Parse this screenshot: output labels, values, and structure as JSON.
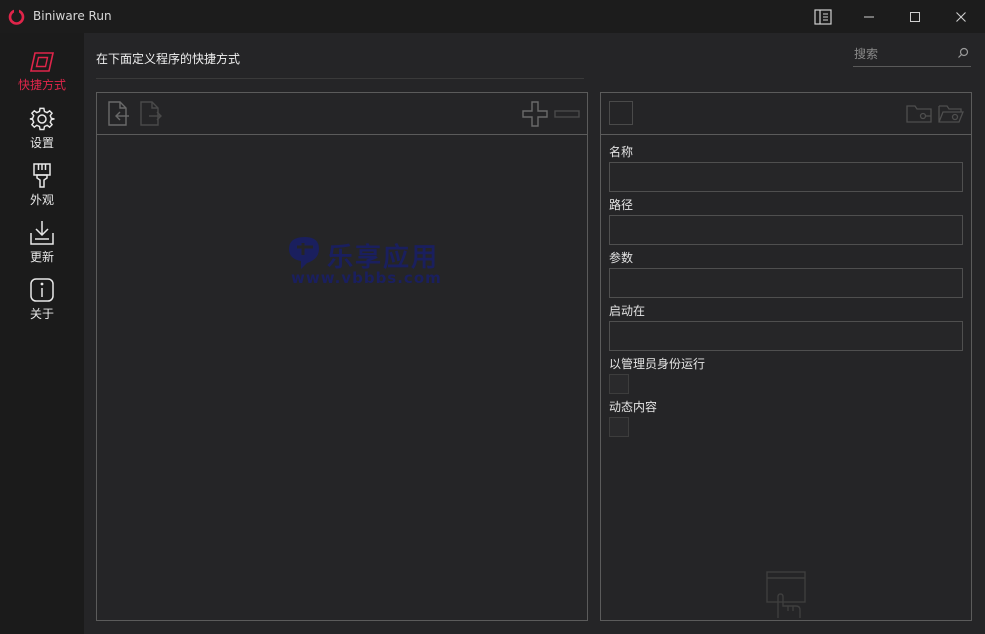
{
  "window": {
    "title": "Biniware Run",
    "accent_color": "#e0254a",
    "controls": [
      "reader-icon",
      "minimize-icon",
      "maximize-icon",
      "close-icon"
    ]
  },
  "sidebar": {
    "items": [
      {
        "label": "快捷方式",
        "icon": "shortcut-icon",
        "active": true
      },
      {
        "label": "设置",
        "icon": "gear-icon",
        "active": false
      },
      {
        "label": "外观",
        "icon": "brush-icon",
        "active": false
      },
      {
        "label": "更新",
        "icon": "download-icon",
        "active": false
      },
      {
        "label": "关于",
        "icon": "info-icon",
        "active": false
      }
    ]
  },
  "header": {
    "heading": "在下面定义程序的快捷方式",
    "search_placeholder": "搜索"
  },
  "list_panel": {
    "toolbar_icons": [
      "import-icon",
      "export-icon",
      "add-icon",
      "remove-icon"
    ]
  },
  "details_panel": {
    "toolbar_icons": [
      "program-icon-placeholder",
      "open-folder-icon",
      "browse-folder-icon"
    ],
    "fields": {
      "name_label": "名称",
      "path_label": "路径",
      "params_label": "参数",
      "startin_label": "启动在",
      "admin_label": "以管理员身份运行",
      "dynamic_label": "动态内容"
    },
    "values": {
      "name": "",
      "path": "",
      "params": "",
      "startin": ""
    },
    "admin_checked": false,
    "dynamic_checked": false,
    "bottom_icon": "drag-click-icon"
  },
  "watermark": {
    "title": "乐享应用",
    "url": "www.vbbbs.com"
  }
}
